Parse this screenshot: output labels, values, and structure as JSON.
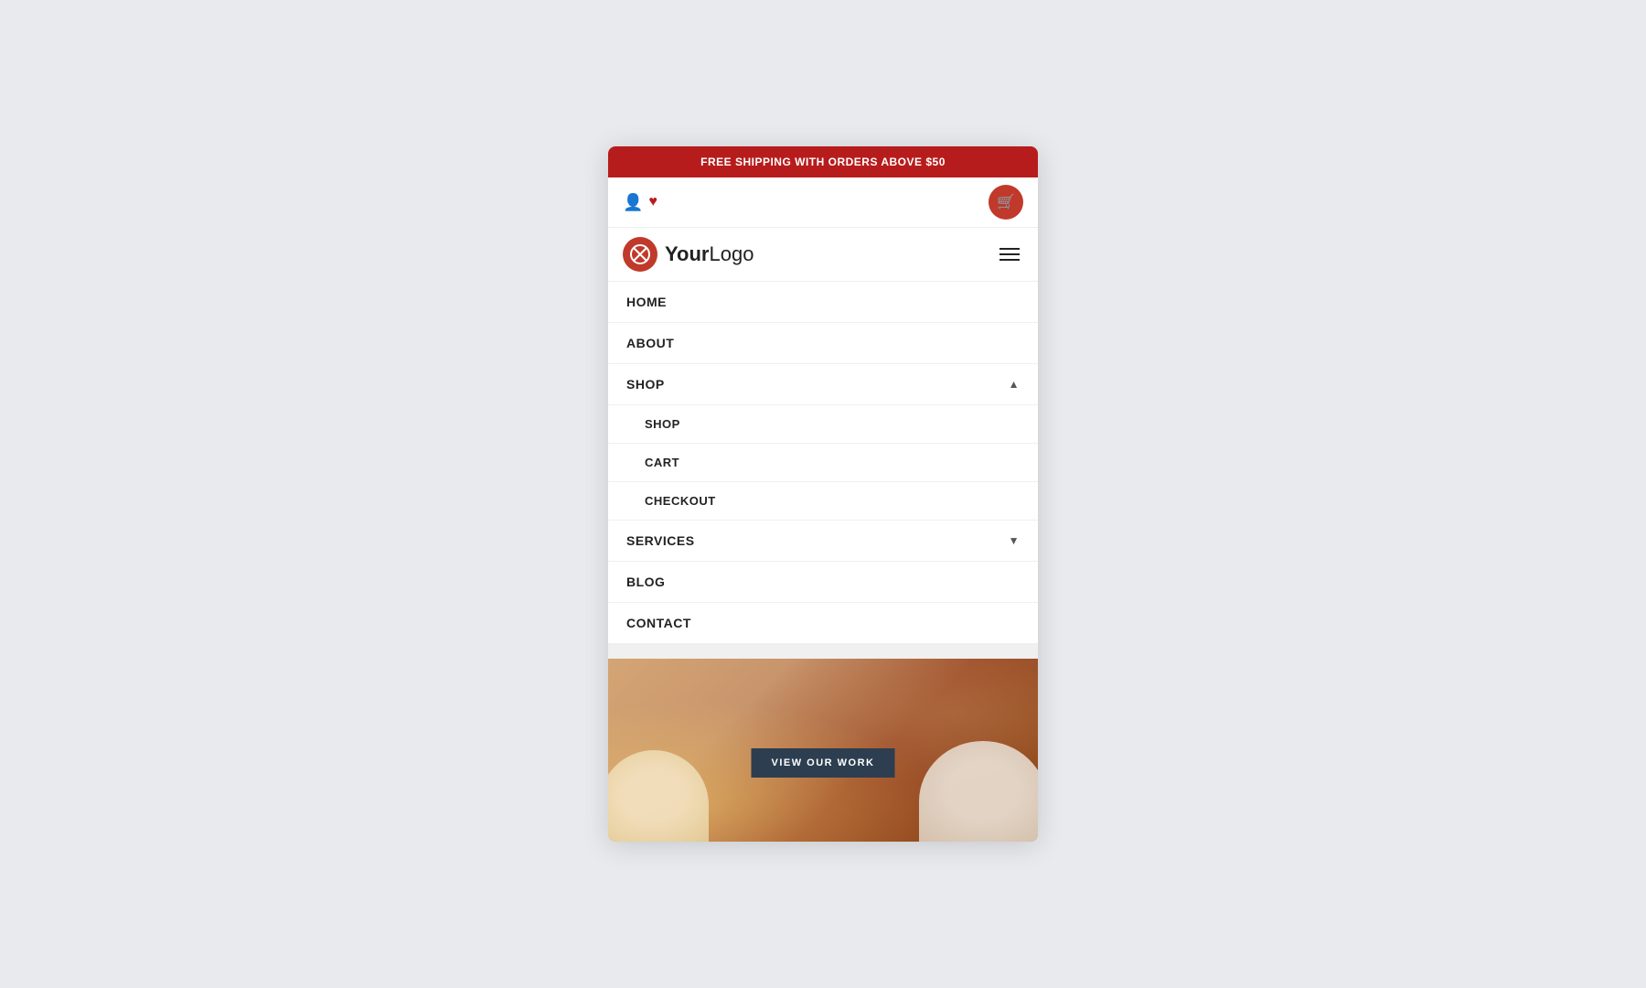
{
  "promoBanner": {
    "text": "FREE SHIPPING WITH ORDERS ABOVE $50"
  },
  "header": {
    "logo": {
      "icon": "⊘",
      "boldText": "Your",
      "regularText": "Logo"
    },
    "cartButton": {
      "icon": "🛒"
    }
  },
  "navigation": {
    "items": [
      {
        "label": "HOME",
        "hasSubmenu": false
      },
      {
        "label": "ABOUT",
        "hasSubmenu": false
      },
      {
        "label": "SHOP",
        "hasSubmenu": true,
        "expanded": true,
        "chevron": "▲",
        "submenu": [
          {
            "label": "SHOP"
          },
          {
            "label": "CART"
          },
          {
            "label": "CHECKOUT"
          }
        ]
      },
      {
        "label": "SERVICES",
        "hasSubmenu": true,
        "expanded": false,
        "chevron": "▼"
      },
      {
        "label": "BLOG",
        "hasSubmenu": false
      },
      {
        "label": "CONTACT",
        "hasSubmenu": false
      }
    ]
  },
  "hero": {
    "buttonLabel": "VIEW OUR WORK"
  },
  "colors": {
    "accent": "#c0392b",
    "banner": "#b71c1c",
    "dark": "#2c3e50"
  }
}
